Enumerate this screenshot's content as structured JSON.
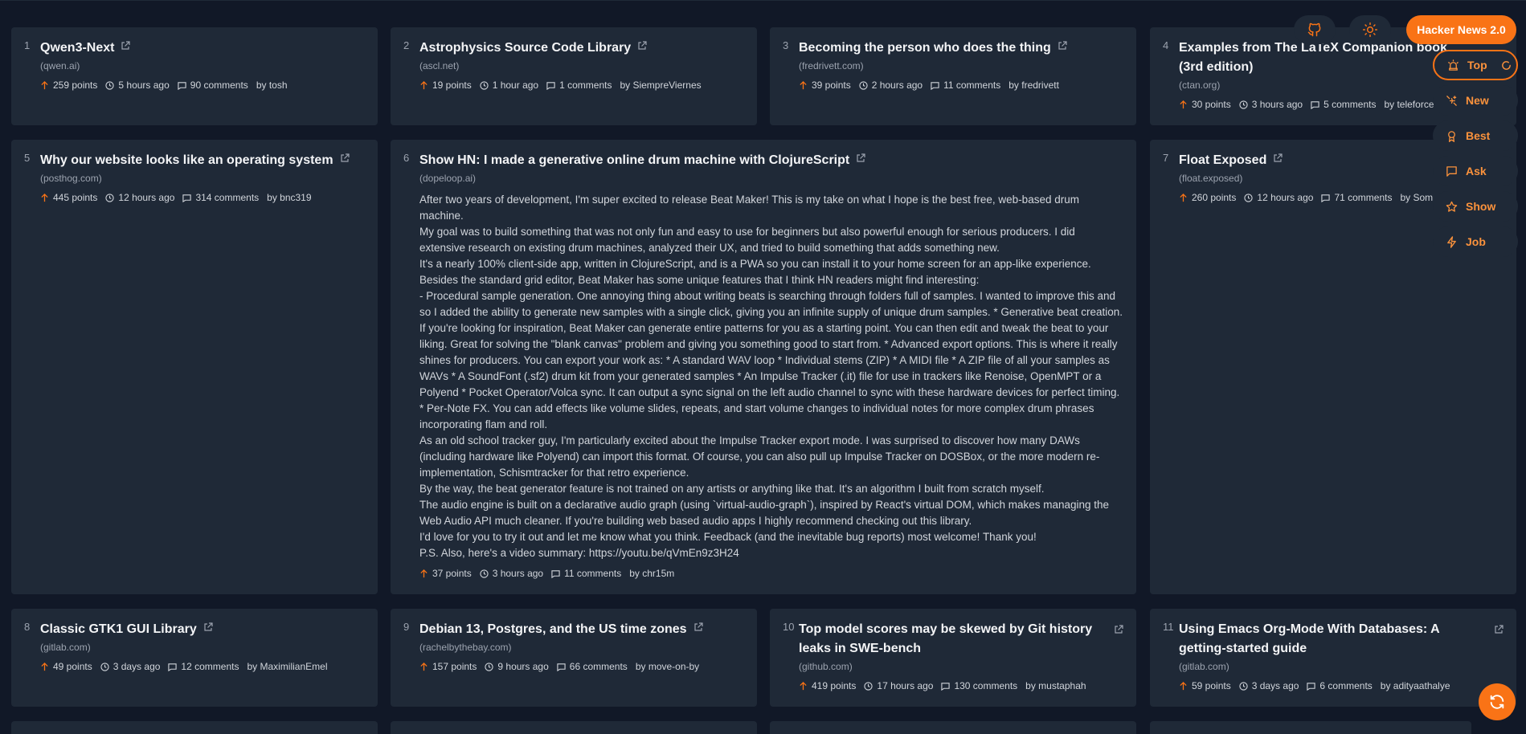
{
  "app": {
    "brand": "Hacker News 2.0",
    "accent_color": "#f97316",
    "icons": {
      "github": "github-icon",
      "theme": "sun-icon",
      "refresh": "refresh-icon"
    }
  },
  "nav": {
    "items": [
      {
        "label": "Top",
        "icon": "alarm-icon",
        "active": true
      },
      {
        "label": "New",
        "icon": "sparkles-icon"
      },
      {
        "label": "Best",
        "icon": "award-icon"
      },
      {
        "label": "Ask",
        "icon": "message-square-icon"
      },
      {
        "label": "Show",
        "icon": "star-icon"
      },
      {
        "label": "Job",
        "icon": "zap-icon"
      }
    ]
  },
  "stories": [
    {
      "rank": "1",
      "title": "Qwen3-Next",
      "domain": "(qwen.ai)",
      "points": "259 points",
      "time": "5 hours ago",
      "comments": "90 comments",
      "by": "by tosh"
    },
    {
      "rank": "2",
      "title": "Astrophysics Source Code Library",
      "domain": "(ascl.net)",
      "points": "19 points",
      "time": "1 hour ago",
      "comments": "1 comments",
      "by": "by SiempreViernes"
    },
    {
      "rank": "3",
      "title": "Becoming the person who does the thing",
      "domain": "(fredrivett.com)",
      "points": "39 points",
      "time": "2 hours ago",
      "comments": "11 comments",
      "by": "by fredrivett"
    },
    {
      "rank": "4",
      "title": "Examples from The LaTeX Companion book (3rd edition)",
      "domain": "(ctan.org)",
      "points": "30 points",
      "time": "3 hours ago",
      "comments": "5 comments",
      "by": "by teleforce"
    },
    {
      "rank": "5",
      "title": "Why our website looks like an operating system",
      "domain": "(posthog.com)",
      "points": "445 points",
      "time": "12 hours ago",
      "comments": "314 comments",
      "by": "by bnc319"
    },
    {
      "rank": "6",
      "title": "Show HN: I made a generative online drum machine with ClojureScript",
      "domain": "(dopeloop.ai)",
      "points": "37 points",
      "time": "3 hours ago",
      "comments": "11 comments",
      "by": "by chr15m",
      "text": [
        "After two years of development, I'm super excited to release Beat Maker! This is my take on what I hope is the best free, web-based drum machine.",
        "My goal was to build something that was not only fun and easy to use for beginners but also powerful enough for serious producers. I did extensive research on existing drum machines, analyzed their UX, and tried to build something that adds something new.",
        "It's a nearly 100% client-side app, written in ClojureScript, and is a PWA so you can install it to your home screen for an app-like experience.",
        "Besides the standard grid editor, Beat Maker has some unique features that I think HN readers might find interesting:",
        "- Procedural sample generation. One annoying thing about writing beats is searching through folders full of samples. I wanted to improve this and so I added the ability to generate new samples with a single click, giving you an infinite supply of unique drum samples. * Generative beat creation. If you're looking for inspiration, Beat Maker can generate entire patterns for you as a starting point. You can then edit and tweak the beat to your liking. Great for solving the \"blank canvas\" problem and giving you something good to start from. * Advanced export options. This is where it really shines for producers. You can export your work as: * A standard WAV loop * Individual stems (ZIP) * A MIDI file * A ZIP file of all your samples as WAVs * A SoundFont (.sf2) drum kit from your generated samples * An Impulse Tracker (.it) file for use in trackers like Renoise, OpenMPT or a Polyend * Pocket Operator/Volca sync. It can output a sync signal on the left audio channel to sync with these hardware devices for perfect timing. * Per-Note FX. You can add effects like volume slides, repeats, and start volume changes to individual notes for more complex drum phrases incorporating flam and roll.",
        "As an old school tracker guy, I'm particularly excited about the Impulse Tracker export mode. I was surprised to discover how many DAWs (including hardware like Polyend) can import this format. Of course, you can also pull up Impulse Tracker on DOSBox, or the more modern re-implementation, Schismtracker for that retro experience.",
        "By the way, the beat generator feature is not trained on any artists or anything like that. It's an algorithm I built from scratch myself.",
        "The audio engine is built on a declarative audio graph (using `virtual-audio-graph`), inspired by React's virtual DOM, which makes managing the Web Audio API much cleaner. If you're building web based audio apps I highly recommend checking out this library.",
        "I'd love for you to try it out and let me know what you think. Feedback (and the inevitable bug reports) most welcome! Thank you!",
        "P.S. Also, here's a video summary: https://youtu.be/qVmEn9z3H24"
      ]
    },
    {
      "rank": "7",
      "title": "Float Exposed",
      "domain": "(float.exposed)",
      "points": "260 points",
      "time": "12 hours ago",
      "comments": "71 comments",
      "by": "by Som"
    },
    {
      "rank": "8",
      "title": "Classic GTK1 GUI Library",
      "domain": "(gitlab.com)",
      "points": "49 points",
      "time": "3 days ago",
      "comments": "12 comments",
      "by": "by MaximilianEmel"
    },
    {
      "rank": "9",
      "title": "Debian 13, Postgres, and the US time zones",
      "domain": "(rachelbythebay.com)",
      "points": "157 points",
      "time": "9 hours ago",
      "comments": "66 comments",
      "by": "by move-on-by"
    },
    {
      "rank": "10",
      "title": "Top model scores may be skewed by Git history leaks in SWE-bench",
      "domain": "(github.com)",
      "points": "419 points",
      "time": "17 hours ago",
      "comments": "130 comments",
      "by": "by mustaphah"
    },
    {
      "rank": "11",
      "title": "Using Emacs Org-Mode With Databases: A getting-started guide",
      "domain": "(gitlab.com)",
      "points": "59 points",
      "time": "3 days ago",
      "comments": "6 comments",
      "by": "by adityaathalye"
    }
  ]
}
